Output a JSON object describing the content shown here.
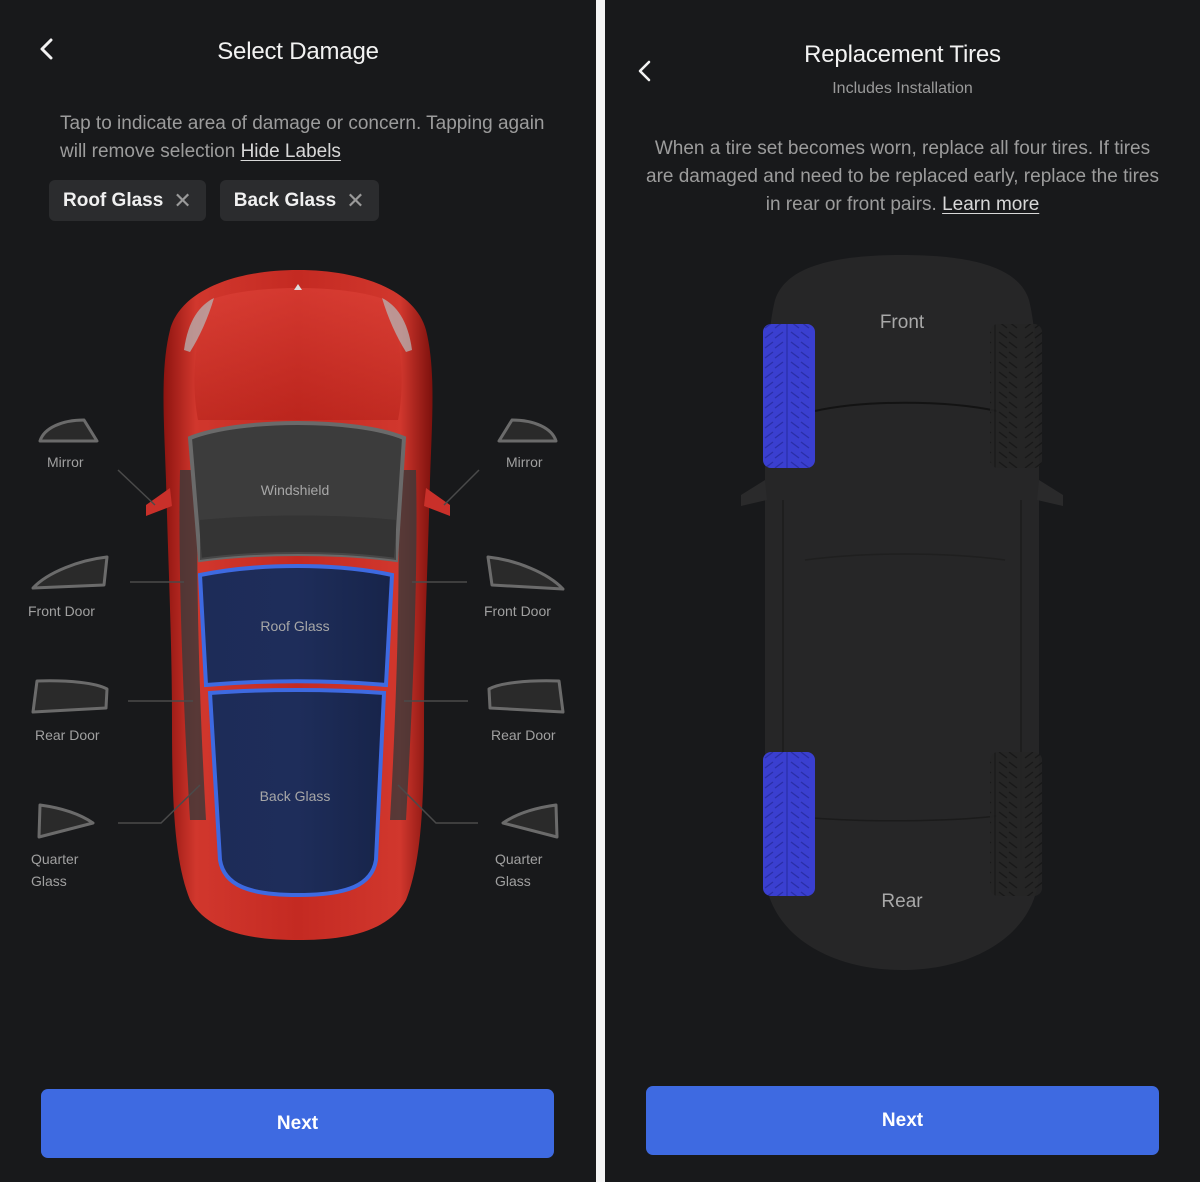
{
  "left_screen": {
    "title": "Select Damage",
    "instructions": "Tap to indicate area of damage or concern. Tapping again will remove selection",
    "hide_labels_link": "Hide Labels",
    "selected_chips": [
      {
        "label": "Roof Glass",
        "remove_icon": "close-icon"
      },
      {
        "label": "Back Glass",
        "remove_icon": "close-icon"
      }
    ],
    "car_glass_parts": [
      {
        "id": "windshield",
        "label": "Windshield",
        "selected": false
      },
      {
        "id": "roof-glass",
        "label": "Roof Glass",
        "selected": true
      },
      {
        "id": "back-glass",
        "label": "Back Glass",
        "selected": true
      }
    ],
    "side_parts_left": [
      {
        "id": "mirror-left",
        "label": "Mirror"
      },
      {
        "id": "front-door-left",
        "label": "Front Door"
      },
      {
        "id": "rear-door-left",
        "label": "Rear Door"
      },
      {
        "id": "quarter-glass-left",
        "label_line1": "Quarter",
        "label_line2": "Glass"
      }
    ],
    "side_parts_right": [
      {
        "id": "mirror-right",
        "label": "Mirror"
      },
      {
        "id": "front-door-right",
        "label": "Front Door"
      },
      {
        "id": "rear-door-right",
        "label": "Rear Door"
      },
      {
        "id": "quarter-glass-right",
        "label_line1": "Quarter",
        "label_line2": "Glass"
      }
    ],
    "next_label": "Next",
    "colors": {
      "car_body": "#c62a23",
      "selection": "#3e6ae1",
      "selected_fill": "#1c2a52"
    }
  },
  "right_screen": {
    "title": "Replacement Tires",
    "subtitle": "Includes Installation",
    "description": "When a tire set becomes worn, replace all four tires. If tires are damaged and need to be replaced early, replace the tires in rear or front pairs.",
    "learn_more_link": "Learn more",
    "front_label": "Front",
    "rear_label": "Rear",
    "tires": [
      {
        "id": "front-left",
        "selected": true
      },
      {
        "id": "front-right",
        "selected": false
      },
      {
        "id": "rear-left",
        "selected": true
      },
      {
        "id": "rear-right",
        "selected": false
      }
    ],
    "next_label": "Next",
    "colors": {
      "selected_tire": "#3a3fd0",
      "accent": "#3e6ae1"
    }
  }
}
